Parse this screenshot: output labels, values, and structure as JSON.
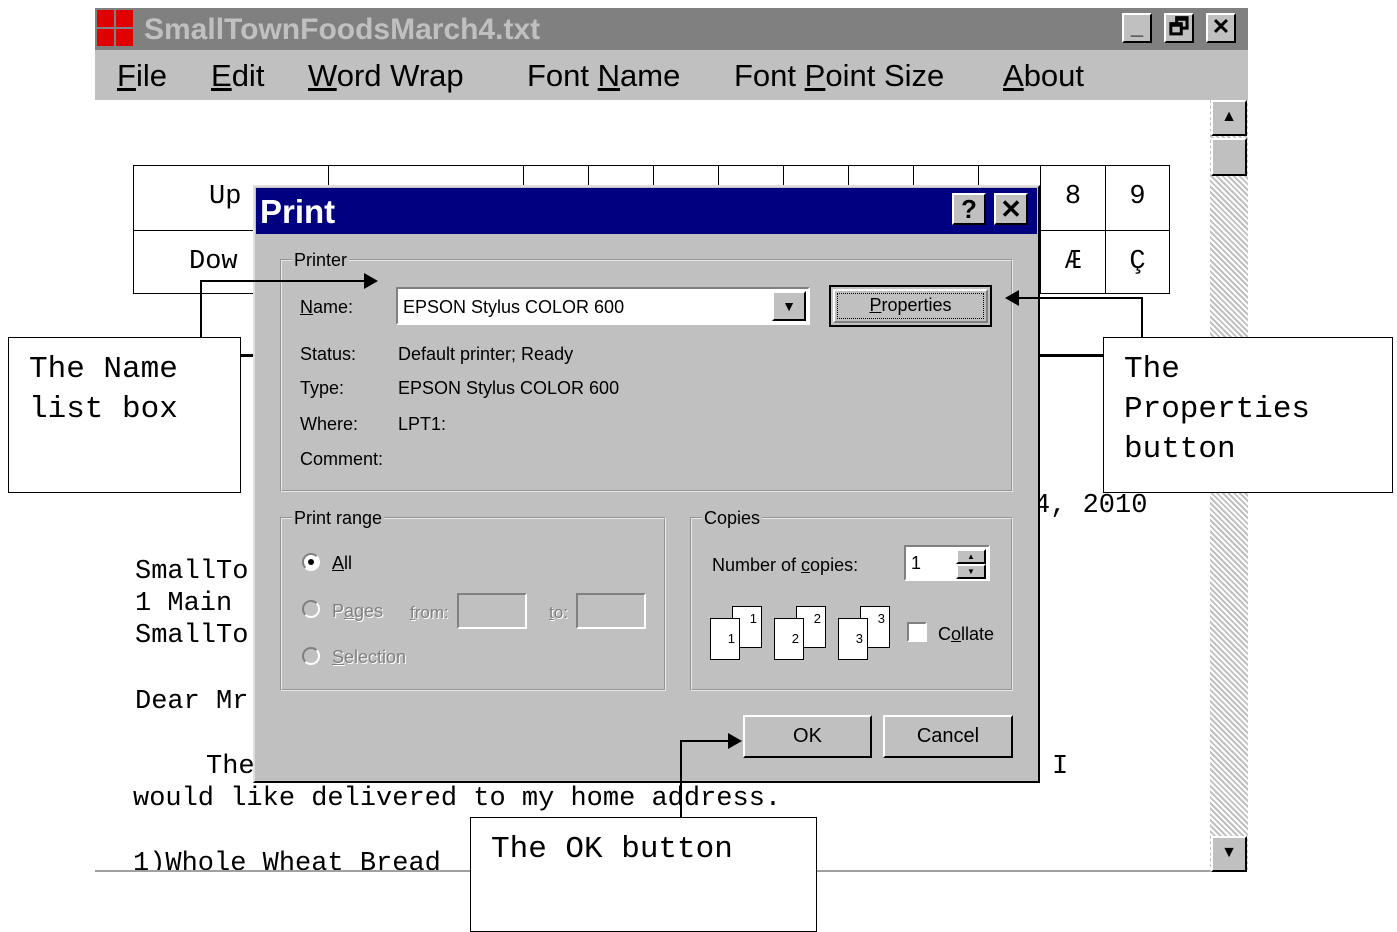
{
  "window": {
    "title": "SmallTownFoodsMarch4.txt",
    "controls": {
      "minimize": "_",
      "restore": "🗗",
      "close": "✕"
    }
  },
  "menu": {
    "file": "File",
    "edit": "Edit",
    "word_wrap": "Word Wrap",
    "font_name": "Font Name",
    "font_point_size": "Font Point Size",
    "about": "About"
  },
  "document": {
    "table": {
      "row1_label": "Up",
      "row2_label": "Dow",
      "row1_right": [
        "8",
        "9"
      ],
      "row2_right": [
        "Æ",
        "Ç"
      ]
    },
    "date_fragment": "4, 2010",
    "lines": [
      "SmallTo",
      "1 Main",
      "SmallTo",
      "Dear Mr",
      "The",
      "I",
      "would like delivered to my home address.",
      "1)Whole Wheat Bread"
    ]
  },
  "dialog": {
    "title": "Print",
    "help": "?",
    "close": "✕",
    "printer": {
      "group": "Printer",
      "name_label": "Name:",
      "name_value": "EPSON Stylus COLOR 600",
      "properties": "Properties",
      "status_label": "Status:",
      "status_value": "Default printer; Ready",
      "type_label": "Type:",
      "type_value": "EPSON Stylus COLOR 600",
      "where_label": "Where:",
      "where_value": "LPT1:",
      "comment_label": "Comment:"
    },
    "range": {
      "group": "Print range",
      "all": "All",
      "pages": "Pages",
      "from": "from:",
      "to": "to:",
      "selection": "Selection",
      "selected": "all"
    },
    "copies": {
      "group": "Copies",
      "number_label": "Number of copies:",
      "number_value": "1",
      "collate": "Collate",
      "collate_checked": false,
      "page_numbers": [
        "1",
        "1",
        "2",
        "2",
        "3",
        "3"
      ]
    },
    "ok": "OK",
    "cancel": "Cancel"
  },
  "callouts": {
    "name_list": "The Name\nlist box",
    "properties": "The\nProperties\nbutton",
    "ok": "The OK button"
  }
}
